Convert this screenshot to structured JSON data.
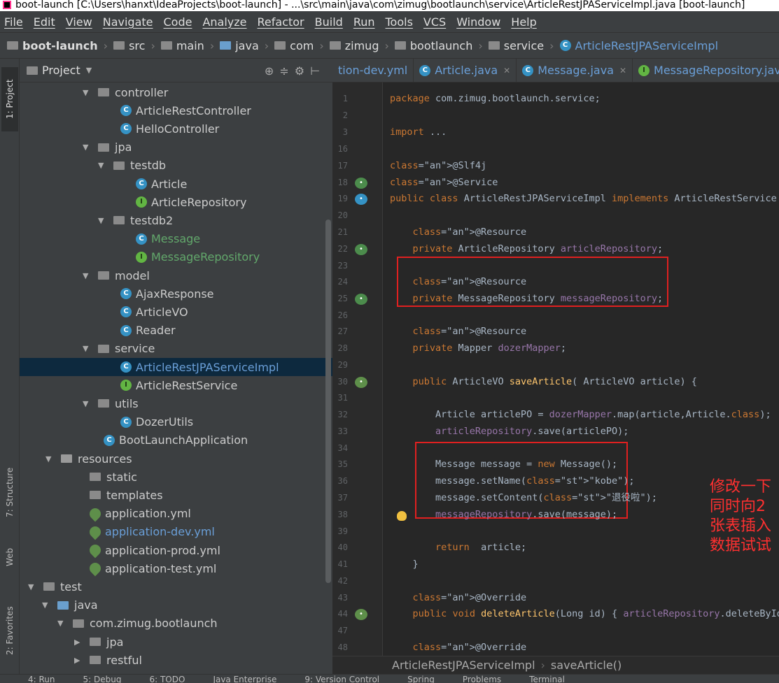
{
  "window": {
    "title": "boot-launch [C:\\Users\\hanxt\\IdeaProjects\\boot-launch] - ...\\src\\main\\java\\com\\zimug\\bootlaunch\\service\\ArticleRestJPAServiceImpl.java [boot-launch]"
  },
  "menu": [
    "File",
    "Edit",
    "View",
    "Navigate",
    "Code",
    "Analyze",
    "Refactor",
    "Build",
    "Run",
    "Tools",
    "VCS",
    "Window",
    "Help"
  ],
  "breadcrumb": {
    "items": [
      "boot-launch",
      "src",
      "main",
      "java",
      "com",
      "zimug",
      "bootlaunch",
      "service",
      "ArticleRestJPAServiceImpl"
    ]
  },
  "left_tools": {
    "project": "1: Project",
    "structure": "7: Structure",
    "web": "Web",
    "favorites": "2: Favorites"
  },
  "project_panel": {
    "title": "Project",
    "tree": [
      {
        "label": "controller",
        "kind": "folder",
        "arrow": "▼"
      },
      {
        "label": "ArticleRestController",
        "kind": "class"
      },
      {
        "label": "HelloController",
        "kind": "class"
      },
      {
        "label": "jpa",
        "kind": "folder",
        "arrow": "▼"
      },
      {
        "label": "testdb",
        "kind": "folder",
        "arrow": "▼"
      },
      {
        "label": "Article",
        "kind": "class"
      },
      {
        "label": "ArticleRepository",
        "kind": "interface"
      },
      {
        "label": "testdb2",
        "kind": "folder",
        "arrow": "▼"
      },
      {
        "label": "Message",
        "kind": "class",
        "color": "green"
      },
      {
        "label": "MessageRepository",
        "kind": "interface",
        "color": "green"
      },
      {
        "label": "model",
        "kind": "folder",
        "arrow": "▼"
      },
      {
        "label": "AjaxResponse",
        "kind": "class"
      },
      {
        "label": "ArticleVO",
        "kind": "class"
      },
      {
        "label": "Reader",
        "kind": "class"
      },
      {
        "label": "service",
        "kind": "folder",
        "arrow": "▼"
      },
      {
        "label": "ArticleRestJPAServiceImpl",
        "kind": "class",
        "selected": true
      },
      {
        "label": "ArticleRestService",
        "kind": "interface"
      },
      {
        "label": "utils",
        "kind": "folder",
        "arrow": "▼"
      },
      {
        "label": "DozerUtils",
        "kind": "class"
      },
      {
        "label": "BootLaunchApplication",
        "kind": "class"
      },
      {
        "label": "resources",
        "kind": "folder",
        "arrow": "▼"
      },
      {
        "label": "static",
        "kind": "folder"
      },
      {
        "label": "templates",
        "kind": "folder"
      },
      {
        "label": "application.yml",
        "kind": "yml"
      },
      {
        "label": "application-dev.yml",
        "kind": "yml",
        "color": "blue"
      },
      {
        "label": "application-prod.yml",
        "kind": "yml"
      },
      {
        "label": "application-test.yml",
        "kind": "yml"
      },
      {
        "label": "test",
        "kind": "folder",
        "arrow": "▼"
      },
      {
        "label": "java",
        "kind": "folder",
        "arrow": "▼"
      },
      {
        "label": "com.zimug.bootlaunch",
        "kind": "folder",
        "arrow": "▼"
      },
      {
        "label": "jpa",
        "kind": "folder",
        "arrow": "▶"
      },
      {
        "label": "restful",
        "kind": "folder",
        "arrow": "▶"
      }
    ]
  },
  "tabs": [
    {
      "label": "tion-dev.yml",
      "active": false
    },
    {
      "label": "Article.java",
      "active": false
    },
    {
      "label": "Message.java",
      "active": false
    },
    {
      "label": "MessageRepository.java",
      "active": false
    }
  ],
  "line_numbers": [
    "1",
    "2",
    "3",
    "16",
    "17",
    "18",
    "19",
    "20",
    "21",
    "22",
    "23",
    "24",
    "25",
    "26",
    "27",
    "28",
    "29",
    "30",
    "31",
    "32",
    "33",
    "34",
    "35",
    "36",
    "37",
    "38",
    "39",
    "40",
    "41",
    "42",
    "43",
    "44",
    "47",
    "48"
  ],
  "code_lines": [
    "package com.zimug.bootlaunch.service;",
    "",
    "import ...",
    "",
    "@Slf4j",
    "@Service",
    "public class ArticleRestJPAServiceImpl implements ArticleRestService",
    "",
    "    @Resource",
    "    private ArticleRepository articleRepository;",
    "",
    "    @Resource",
    "    private MessageRepository messageRepository;",
    "",
    "    @Resource",
    "    private Mapper dozerMapper;",
    "",
    "    public ArticleVO saveArticle( ArticleVO article) {",
    "",
    "        Article articlePO = dozerMapper.map(article,Article.class);",
    "        articleRepository.save(articlePO);",
    "",
    "        Message message = new Message();",
    "        message.setName(\"kobe\");",
    "        message.setContent(\"退役啦\");",
    "        messageRepository.save(message);",
    "",
    "        return  article;",
    "    }",
    "",
    "    @Override",
    "    public void deleteArticle(Long id) { articleRepository.deleteById(",
    "",
    "    @Override"
  ],
  "annotation": [
    "修改一下",
    "同时向2张表插入",
    "数据试试"
  ],
  "editor_breadcrumb": [
    "ArticleRestJPAServiceImpl",
    "saveArticle()"
  ],
  "statusbar": [
    "4: Run",
    "5: Debug",
    "6: TODO",
    "Java Enterprise",
    "9: Version Control",
    "Spring",
    "Problems",
    "Terminal"
  ],
  "colors": {
    "keyword": "#cc7832",
    "annotation": "#bbb529",
    "field": "#9876aa",
    "string": "#6a8759",
    "method": "#ffc66d",
    "highlight_box": "#e02020"
  }
}
